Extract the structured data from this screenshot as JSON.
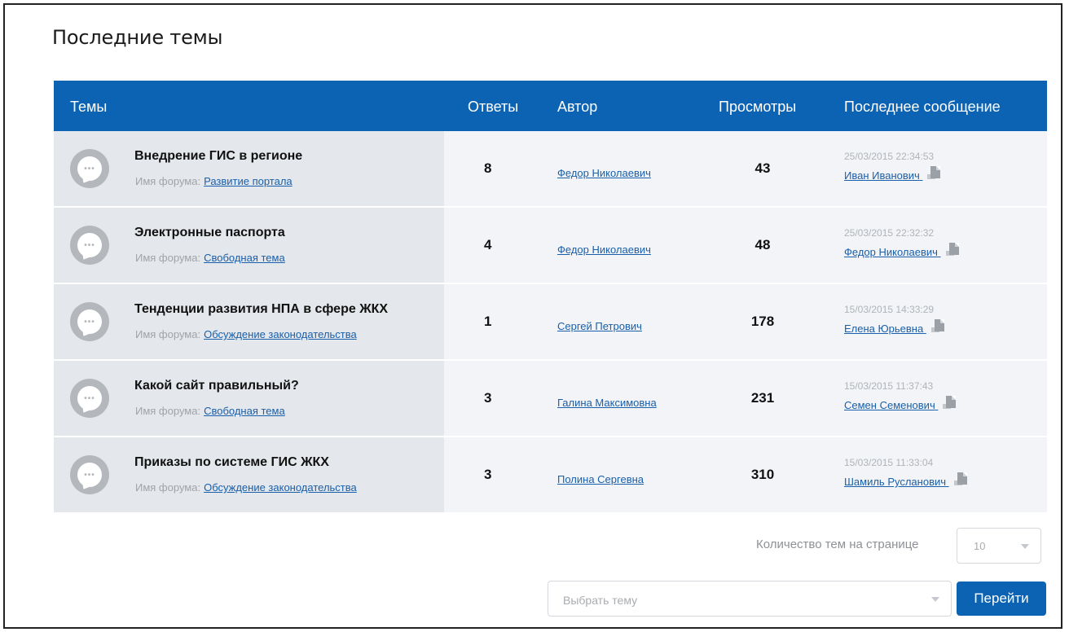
{
  "page": {
    "title": "Последние темы"
  },
  "table": {
    "headers": {
      "topics": "Темы",
      "answers": "Ответы",
      "author": "Автор",
      "views": "Просмотры",
      "last_message": "Последнее сообщение"
    },
    "forum_label": "Имя форума:",
    "rows": [
      {
        "title": "Внедрение ГИС в регионе",
        "forum": "Развитие портала",
        "answers": "8",
        "author": "Федор Николаевич",
        "views": "43",
        "last_date": "25/03/2015 22:34:53",
        "last_author": "Иван Иванович"
      },
      {
        "title": "Электронные паспорта",
        "forum": "Свободная тема",
        "answers": "4",
        "author": "Федор Николаевич",
        "views": "48",
        "last_date": "25/03/2015 22:32:32",
        "last_author": "Федор Николаевич"
      },
      {
        "title": "Тенденции развития НПА в сфере ЖКХ",
        "forum": "Обсуждение законодательства",
        "answers": "1",
        "author": "Сергей Петрович",
        "views": "178",
        "last_date": "15/03/2015 14:33:29",
        "last_author": "Елена Юрьевна"
      },
      {
        "title": "Какой сайт правильный?",
        "forum": "Свободная тема",
        "answers": "3",
        "author": "Галина Максимовна",
        "views": "231",
        "last_date": "15/03/2015 11:37:43",
        "last_author": "Семен Семенович"
      },
      {
        "title": "Приказы по системе ГИС ЖКХ",
        "forum": "Обсуждение законодательства",
        "answers": "3",
        "author": "Полина Сергевна",
        "views": "310",
        "last_date": "15/03/2015 11:33:04",
        "last_author": "Шамиль Русланович"
      }
    ]
  },
  "pagination": {
    "per_page_label": "Количество тем на странице",
    "per_page_value": "10"
  },
  "navigation": {
    "select_placeholder": "Выбрать тему",
    "go_label": "Перейти"
  },
  "colors": {
    "accent": "#0d63b3",
    "link": "#1a5fa9"
  },
  "icons": {
    "topic": "chat-bubble-icon",
    "goto": "goto-message-icon",
    "dropdown": "chevron-down-icon"
  }
}
